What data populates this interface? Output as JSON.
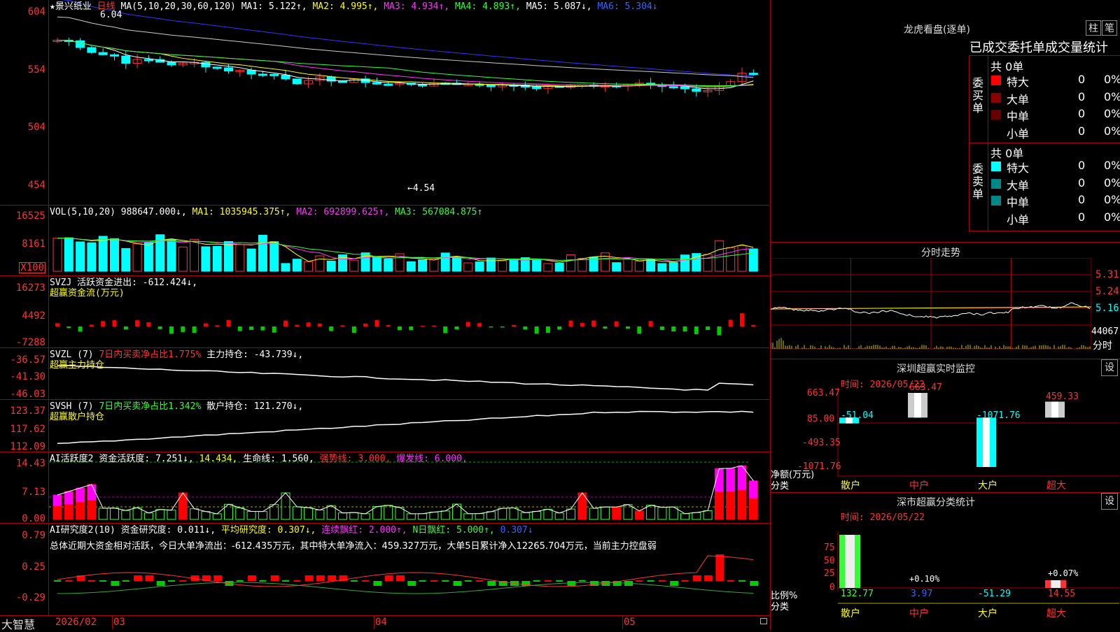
{
  "kline": {
    "title_star": "★",
    "stock_name": "景兴纸业",
    "period": "日线",
    "ma_spec": "MA(5,10,20,30,60,120)",
    "ma1": "MA1: 5.122↑,",
    "ma2": "MA2: 4.995↑,",
    "ma3": "MA3: 4.934↑,",
    "ma4": "MA4: 4.893↑,",
    "ma5": "MA5: 5.087↓,",
    "ma6": "MA6: 5.304↓",
    "y_labels": [
      "604",
      "554",
      "504",
      "454"
    ],
    "high_mark": "6.04",
    "low_mark": "←4.54"
  },
  "vol": {
    "title": "VOL(5,10,20)",
    "value": "988647.000↓,",
    "ma1": "MA1: 1035945.375↑,",
    "ma2": "MA2: 692899.625↑,",
    "ma3": "MA3: 567084.875↑",
    "y_labels": [
      "16525",
      "8161"
    ],
    "unit": "X100"
  },
  "svzj": {
    "title": "SVZJ",
    "label": "活跃资金进出: -612.424↓,",
    "subtitle": "超赢资金流(万元)",
    "y_labels": [
      "16273",
      "4492",
      "-7288"
    ]
  },
  "svzl": {
    "title": "SVZL (7)",
    "desc": "7日内买卖净占比1.775%",
    "label": "主力持仓: -43.739↓,",
    "subtitle": "超赢主力持仓",
    "y_labels": [
      "-36.57",
      "-41.30",
      "-46.03"
    ]
  },
  "svsh": {
    "title": "SVSH (7)",
    "desc": "7日内买卖净占比1.342%",
    "label": "散户持仓: 121.270↓,",
    "subtitle": "超赢散户持仓",
    "y_labels": [
      "123.37",
      "117.62",
      "112.09"
    ]
  },
  "ai1": {
    "title": "AI活跃度2",
    "a": "资金活跃度: 7.251↓,",
    "b": "14.434,",
    "c": "生命线: 1.560,",
    "d": "强势线: 3.000,",
    "e": "爆发线: 6.000,",
    "y_labels": [
      "14.43",
      "7.13",
      "0.00"
    ]
  },
  "ai2": {
    "title": "AI研究度2(10)",
    "a": "资金研究度: 0.011↓,",
    "b": "平均研究度: 0.307↓,",
    "c": "连续飘红: 2.000↑,",
    "d": "N日飘红: 5.000↑,",
    "e": "0.307↓",
    "summary": "总体近期大资金相对活跃，今日大单净流出：-612.435万元，其中特大单净流入：459.327万元，大单5日累计净入12265.704万元，当前主力控盘弱",
    "y_labels": [
      "0.79",
      "0.25",
      "-0.29"
    ]
  },
  "bottom": {
    "brand": "大智慧",
    "dates": [
      "2026/02",
      "03",
      "04",
      "05"
    ]
  },
  "lhb": {
    "title": "龙虎看盘(逐单)",
    "btn1": "柱",
    "btn2": "笔",
    "header": "已成交委托单成交量统计",
    "buy_label": "委买单",
    "sell_label": "委卖单",
    "buy_total": "共 0单",
    "sell_total": "共 0单",
    "buy_rows": [
      {
        "name": "特大",
        "count": "0",
        "pct": "0%",
        "color": "#ff0000"
      },
      {
        "name": "大单",
        "count": "0",
        "pct": "0%",
        "color": "#880000"
      },
      {
        "name": "中单",
        "count": "0",
        "pct": "0%",
        "color": "#660000"
      },
      {
        "name": "小单",
        "count": "0",
        "pct": "0%",
        "color": ""
      }
    ],
    "sell_rows": [
      {
        "name": "特大",
        "count": "0",
        "pct": "0%",
        "color": "#00ffff"
      },
      {
        "name": "大单",
        "count": "0",
        "pct": "0%",
        "color": "#008888"
      },
      {
        "name": "中单",
        "count": "0",
        "pct": "0%",
        "color": "#008888"
      },
      {
        "name": "小单",
        "count": "0",
        "pct": "0%",
        "color": ""
      }
    ]
  },
  "intraday": {
    "title": "分时走势",
    "y_labels": [
      "5.31",
      "5.24",
      "5.16"
    ],
    "vol_label": "44067",
    "unit": "分时"
  },
  "sz_monitor": {
    "title": "深圳超赢实时监控",
    "btn": "设",
    "time": "时间: 2026/05/22",
    "y_labels": [
      "663.47",
      "85.00",
      "-493.35",
      "-1071.76"
    ],
    "unit1": "净额(万元)",
    "unit2": "分类",
    "categories": [
      "散户",
      "中户",
      "大户",
      "超大"
    ],
    "values": [
      "-51.04",
      "663.47",
      "-1071.76",
      "459.33"
    ]
  },
  "class_stats": {
    "title": "深市超赢分类统计",
    "btn": "设",
    "time": "时间: 2026/05/22",
    "y_labels": [
      "75",
      "50",
      "25",
      "0"
    ],
    "unit1": "比例%",
    "unit2": "分类",
    "categories": [
      "散户",
      "中户",
      "大户",
      "超大"
    ],
    "values": [
      "132.77",
      "3.97",
      "-51.29",
      "14.55"
    ],
    "top_labels": [
      "+0.10%",
      "+0.07%"
    ]
  }
}
